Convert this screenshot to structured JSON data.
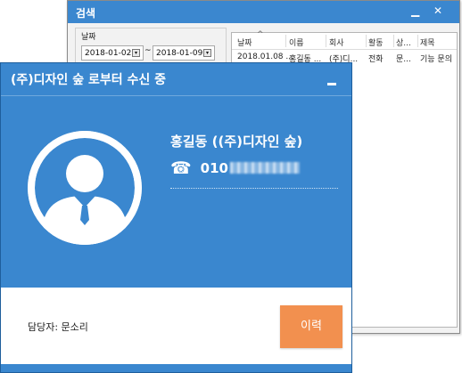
{
  "search_window": {
    "title": "검색",
    "controls": {
      "minimize": "▁",
      "close": "✕"
    },
    "date_group": {
      "label": "날짜",
      "start_date": "2018-01-02",
      "end_date": "2018-01-09",
      "separator": "~"
    },
    "results_table": {
      "columns": [
        "날짜",
        "이름",
        "회사",
        "활동",
        "상...",
        "제목"
      ],
      "rows": [
        [
          "2018.01.08 ...",
          "홍길동 ...",
          "(주)디...",
          "전화",
          "문...",
          "기능 문의"
        ]
      ]
    }
  },
  "call_popup": {
    "title": "(주)디자인 숲 로부터 수신 중",
    "caller_name": "홍길동 ((주)디자인 숲)",
    "phone_prefix": "010",
    "phone_icon": "telephone-icon",
    "manager_label": "담당자: 문소리",
    "history_button": "이력"
  },
  "colors": {
    "popup_blue": "#3a87cf",
    "history_orange": "#f2904f"
  }
}
